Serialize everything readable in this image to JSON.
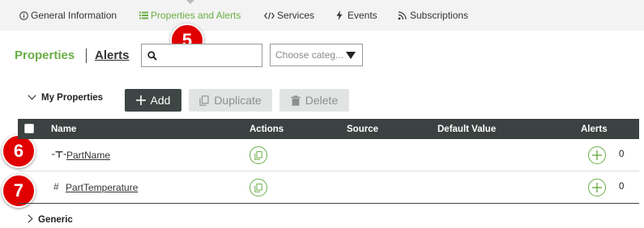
{
  "tabs": [
    {
      "label": "General Information",
      "icon": "info-icon"
    },
    {
      "label": "Properties and Alerts",
      "icon": "list-icon",
      "active": true
    },
    {
      "label": "Services",
      "icon": "code-icon"
    },
    {
      "label": "Events",
      "icon": "lightning-icon"
    },
    {
      "label": "Subscriptions",
      "icon": "feed-icon"
    }
  ],
  "callouts": [
    "5",
    "6",
    "7"
  ],
  "section_tabs": {
    "properties": "Properties",
    "alerts": "Alerts"
  },
  "search": {
    "value": "",
    "placeholder": ""
  },
  "category_select": {
    "placeholder": "Choose categ..."
  },
  "group": {
    "label": "My Properties",
    "add_label": "Add",
    "duplicate_label": "Duplicate",
    "delete_label": "Delete"
  },
  "table": {
    "headers": {
      "name": "Name",
      "actions": "Actions",
      "source": "Source",
      "default_value": "Default Value",
      "alerts": "Alerts"
    },
    "rows": [
      {
        "type_icon": "text-type-icon",
        "name": "PartName",
        "alerts_count": "0"
      },
      {
        "type_icon": "number-type-icon",
        "type_symbol": "#",
        "name": "PartTemperature",
        "alerts_count": "0"
      }
    ]
  },
  "generic_group": {
    "label": "Generic"
  },
  "colors": {
    "accent": "#6aad45",
    "header_dark": "#3b4241",
    "add_button": "#3d4644",
    "callout": "#e00000"
  }
}
